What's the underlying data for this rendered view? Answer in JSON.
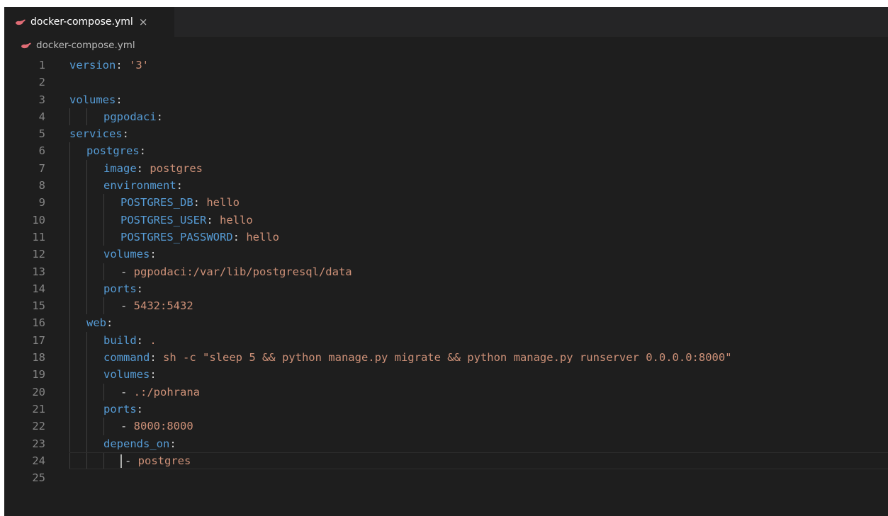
{
  "tab": {
    "icon": "docker-whale-icon",
    "label": "docker-compose.yml",
    "close": "×",
    "accent": "#e06c75"
  },
  "breadcrumb": {
    "icon": "docker-whale-icon",
    "label": "docker-compose.yml"
  },
  "editor": {
    "current_line": 24,
    "lines": [
      {
        "n": "1",
        "indent": 0,
        "tokens": [
          {
            "t": "k",
            "v": "version"
          },
          {
            "t": "p",
            "v": ": "
          },
          {
            "t": "s",
            "v": "'3'"
          }
        ]
      },
      {
        "n": "2",
        "indent": 0,
        "tokens": []
      },
      {
        "n": "3",
        "indent": 0,
        "tokens": [
          {
            "t": "k",
            "v": "volumes"
          },
          {
            "t": "p",
            "v": ":"
          }
        ]
      },
      {
        "n": "4",
        "indent": 2,
        "tokens": [
          {
            "t": "k",
            "v": "pgpodaci"
          },
          {
            "t": "p",
            "v": ":"
          }
        ]
      },
      {
        "n": "5",
        "indent": 0,
        "tokens": [
          {
            "t": "k",
            "v": "services"
          },
          {
            "t": "p",
            "v": ":"
          }
        ]
      },
      {
        "n": "6",
        "indent": 1,
        "tokens": [
          {
            "t": "k",
            "v": "postgres"
          },
          {
            "t": "p",
            "v": ":"
          }
        ]
      },
      {
        "n": "7",
        "indent": 2,
        "tokens": [
          {
            "t": "k",
            "v": "image"
          },
          {
            "t": "p",
            "v": ": "
          },
          {
            "t": "s",
            "v": "postgres"
          }
        ]
      },
      {
        "n": "8",
        "indent": 2,
        "tokens": [
          {
            "t": "k",
            "v": "environment"
          },
          {
            "t": "p",
            "v": ":"
          }
        ]
      },
      {
        "n": "9",
        "indent": 3,
        "tokens": [
          {
            "t": "k",
            "v": "POSTGRES_DB"
          },
          {
            "t": "p",
            "v": ": "
          },
          {
            "t": "s",
            "v": "hello"
          }
        ]
      },
      {
        "n": "10",
        "indent": 3,
        "tokens": [
          {
            "t": "k",
            "v": "POSTGRES_USER"
          },
          {
            "t": "p",
            "v": ": "
          },
          {
            "t": "s",
            "v": "hello"
          }
        ]
      },
      {
        "n": "11",
        "indent": 3,
        "tokens": [
          {
            "t": "k",
            "v": "POSTGRES_PASSWORD"
          },
          {
            "t": "p",
            "v": ": "
          },
          {
            "t": "s",
            "v": "hello"
          }
        ]
      },
      {
        "n": "12",
        "indent": 2,
        "tokens": [
          {
            "t": "k",
            "v": "volumes"
          },
          {
            "t": "p",
            "v": ":"
          }
        ]
      },
      {
        "n": "13",
        "indent": 3,
        "tokens": [
          {
            "t": "p",
            "v": "- "
          },
          {
            "t": "s",
            "v": "pgpodaci:/var/lib/postgresql/data"
          }
        ]
      },
      {
        "n": "14",
        "indent": 2,
        "tokens": [
          {
            "t": "k",
            "v": "ports"
          },
          {
            "t": "p",
            "v": ":"
          }
        ]
      },
      {
        "n": "15",
        "indent": 3,
        "tokens": [
          {
            "t": "p",
            "v": "- "
          },
          {
            "t": "s",
            "v": "5432:5432"
          }
        ]
      },
      {
        "n": "16",
        "indent": 1,
        "tokens": [
          {
            "t": "k",
            "v": "web"
          },
          {
            "t": "p",
            "v": ":"
          }
        ]
      },
      {
        "n": "17",
        "indent": 2,
        "tokens": [
          {
            "t": "k",
            "v": "build"
          },
          {
            "t": "p",
            "v": ": "
          },
          {
            "t": "s",
            "v": "."
          }
        ]
      },
      {
        "n": "18",
        "indent": 2,
        "tokens": [
          {
            "t": "k",
            "v": "command"
          },
          {
            "t": "p",
            "v": ": "
          },
          {
            "t": "s",
            "v": "sh -c \"sleep 5 && python manage.py migrate && python manage.py runserver 0.0.0.0:8000\""
          }
        ]
      },
      {
        "n": "19",
        "indent": 2,
        "tokens": [
          {
            "t": "k",
            "v": "volumes"
          },
          {
            "t": "p",
            "v": ":"
          }
        ]
      },
      {
        "n": "20",
        "indent": 3,
        "tokens": [
          {
            "t": "p",
            "v": "- "
          },
          {
            "t": "s",
            "v": ".:/pohrana"
          }
        ]
      },
      {
        "n": "21",
        "indent": 2,
        "tokens": [
          {
            "t": "k",
            "v": "ports"
          },
          {
            "t": "p",
            "v": ":"
          }
        ]
      },
      {
        "n": "22",
        "indent": 3,
        "tokens": [
          {
            "t": "p",
            "v": "- "
          },
          {
            "t": "s",
            "v": "8000:8000"
          }
        ]
      },
      {
        "n": "23",
        "indent": 2,
        "tokens": [
          {
            "t": "k",
            "v": "depends_on"
          },
          {
            "t": "p",
            "v": ":"
          }
        ]
      },
      {
        "n": "24",
        "indent": 3,
        "tokens": [
          {
            "t": "p",
            "v": "- "
          },
          {
            "t": "s",
            "v": "postgres"
          }
        ]
      },
      {
        "n": "25",
        "indent": 0,
        "tokens": []
      }
    ]
  },
  "colors": {
    "background": "#1e1e1e",
    "tabbar": "#252526",
    "key": "#569cd6",
    "string": "#ce9178",
    "line_number": "#858585"
  }
}
